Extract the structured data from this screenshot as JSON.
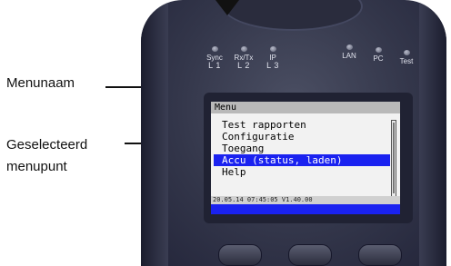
{
  "callouts": {
    "menu_name": "Menunaam",
    "selected_line1": "Geselecteerd",
    "selected_line2": "menupunt"
  },
  "leds": [
    {
      "top": "Sync",
      "bottom": "L 1"
    },
    {
      "top": "Rx/Tx",
      "bottom": "L 2"
    },
    {
      "top": "IP",
      "bottom": "L 3"
    },
    {
      "top": "LAN",
      "bottom": ""
    },
    {
      "top": "PC",
      "bottom": ""
    },
    {
      "top": "Test",
      "bottom": ""
    }
  ],
  "screen": {
    "title": "Menu",
    "menu_items": [
      {
        "label": "Test rapporten",
        "selected": false
      },
      {
        "label": "Configuratie",
        "selected": false
      },
      {
        "label": "Toegang",
        "selected": false
      },
      {
        "label": "Accu (status, laden)",
        "selected": true
      },
      {
        "label": "Help",
        "selected": false
      }
    ],
    "status": "20.05.14 07:45:05 V1.40.00"
  },
  "colors": {
    "selection": "#1a22f0",
    "device_body": "#33364a"
  }
}
